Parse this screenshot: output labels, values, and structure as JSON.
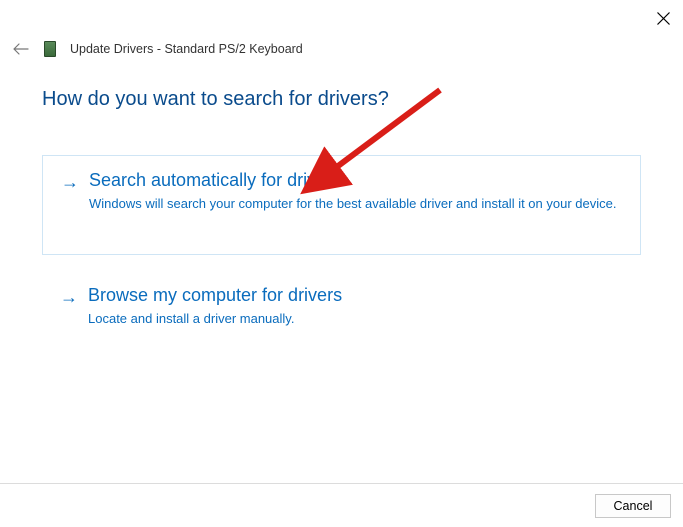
{
  "window": {
    "title": "Update Drivers - Standard PS/2 Keyboard"
  },
  "heading": "How do you want to search for drivers?",
  "options": {
    "auto": {
      "title": "Search automatically for drivers",
      "desc": "Windows will search your computer for the best available driver and install it on your device."
    },
    "browse": {
      "title": "Browse my computer for drivers",
      "desc": "Locate and install a driver manually."
    }
  },
  "buttons": {
    "cancel": "Cancel"
  },
  "colors": {
    "link": "#0a6cbd",
    "heading": "#0a4b8c",
    "annotation": "#d91e18"
  }
}
